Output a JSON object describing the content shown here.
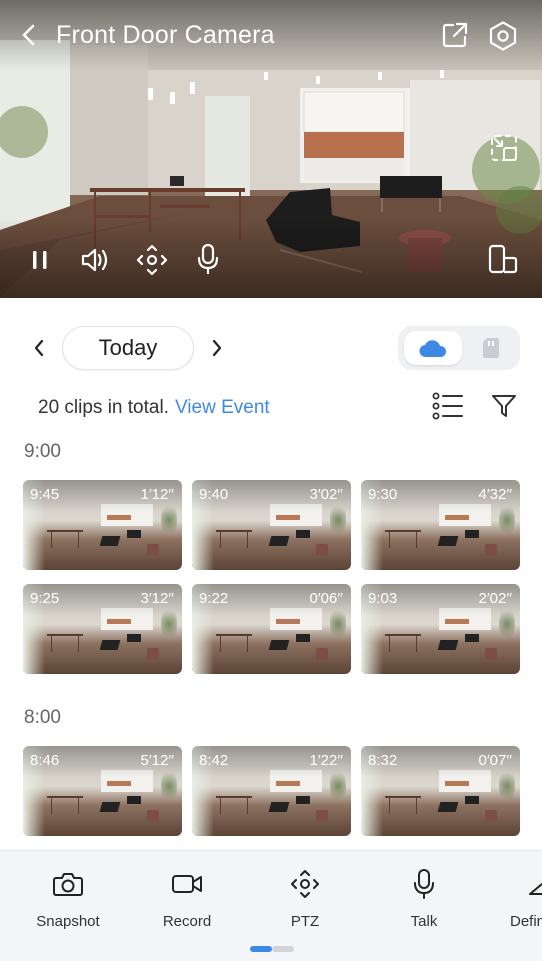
{
  "camera": {
    "title": "Front Door Camera",
    "controls": [
      "pause",
      "volume",
      "ptz",
      "microphone"
    ]
  },
  "date_nav": {
    "current": "Today",
    "storage_options": [
      "cloud",
      "sd-card"
    ],
    "storage_selected": "cloud",
    "accent": "#3d8ae6"
  },
  "summary": {
    "text": "20 clips in total.",
    "link": "View Event"
  },
  "groups": [
    {
      "label": "9:00",
      "clips": [
        {
          "time": "9:45",
          "duration": "1′12′′"
        },
        {
          "time": "9:40",
          "duration": "3′02′′"
        },
        {
          "time": "9:30",
          "duration": "4′32′′"
        },
        {
          "time": "9:25",
          "duration": "3′12′′"
        },
        {
          "time": "9:22",
          "duration": "0′06′′"
        },
        {
          "time": "9:03",
          "duration": "2′02′′"
        }
      ]
    },
    {
      "label": "8:00",
      "clips": [
        {
          "time": "8:46",
          "duration": "5′12′′"
        },
        {
          "time": "8:42",
          "duration": "1′22′′"
        },
        {
          "time": "8:32",
          "duration": "0′07′′"
        }
      ]
    }
  ],
  "toolbar": {
    "items": [
      {
        "label": "Snapshot",
        "icon": "camera-icon"
      },
      {
        "label": "Record",
        "icon": "video-icon"
      },
      {
        "label": "PTZ",
        "icon": "ptz-icon"
      },
      {
        "label": "Talk",
        "icon": "microphone-icon"
      },
      {
        "label": "Definition",
        "icon": "definition-icon"
      }
    ],
    "page_indicator": {
      "current": 1,
      "total": 2
    }
  }
}
